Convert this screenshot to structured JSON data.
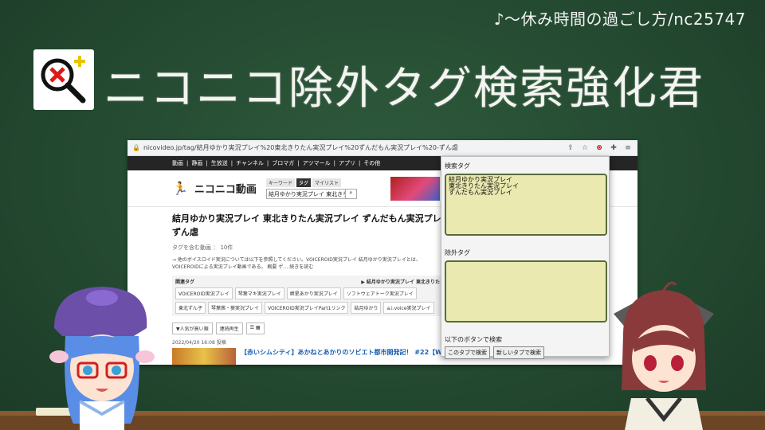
{
  "credit": "♪〜休み時間の過ごし方/nc25747",
  "main_title": "ニコニコ除外タグ検索強化君",
  "browser": {
    "url": "nicovideo.jp/tag/結月ゆかり実況プレイ%20東北きりたん実況プレイ%20ずんだもん実況プレイ%20-ずん虐",
    "nav_items": [
      "動画",
      "静画",
      "生放送",
      "チャンネル",
      "ブロマガ",
      "アツマール",
      "アプリ",
      "その他"
    ],
    "logo_text": "ニコニコ動画",
    "search_tabs": [
      "キーワード",
      "タグ",
      "マイリスト"
    ],
    "search_value": "結月ゆかり実況プレイ 東北きり",
    "page_title": "結月ゆかり実況プレイ 東北きりたん実況プレイ ずんだもん実況プレイ -ずん虐",
    "video_count": "タグを含む動画 ： 10件",
    "description": "→ 他のボイスロイド実況については以下を参照してください。VOICEROID実況プレイ 結月ゆかり実況プレイとは、VOICEROIDによる実況プレイ動画である。 概要 ゲ… 続きを読む",
    "related_label": "関連タグ",
    "related_right": "▶ 結月ゆかり実況プレイ 東北きりた",
    "related_tags": [
      "VOICEROID実況プレイ",
      "琴葉マキ実況プレイ",
      "紲星あかり実況プレイ",
      "ソフトウェアトーク実況プレイ",
      "東北ずん子",
      "琴葉茜・葵実況プレイ",
      "VOICEROID実況プレイPart1リンク",
      "結月ゆかり",
      "a.i.voice実況プレイ"
    ],
    "sort_label": "▼人気が高い順",
    "continuous_label": "連続再生",
    "video_date": "2022/04/20 16:08 投稿",
    "video_title": "【赤いシムシティ】あかねとあかりのソビエト都市開発記！ #22【Workers & Re..."
  },
  "popup": {
    "search_tags_label": "検索タグ",
    "search_tags_value": "結月ゆかり実況プレイ\n東北きりたん実況プレイ\nずんだもん実況プレイ",
    "exclude_tags_label": "除外タグ",
    "exclude_tags_value": "",
    "button_hint": "以下のボタンで検索",
    "search_this_tab": "このタブで検索",
    "search_new_tab": "新しいタブで検索"
  },
  "colors": {
    "board": "#2f5a3c",
    "textarea_bg": "#e9e9b0",
    "textarea_border": "#5a6b3a"
  }
}
